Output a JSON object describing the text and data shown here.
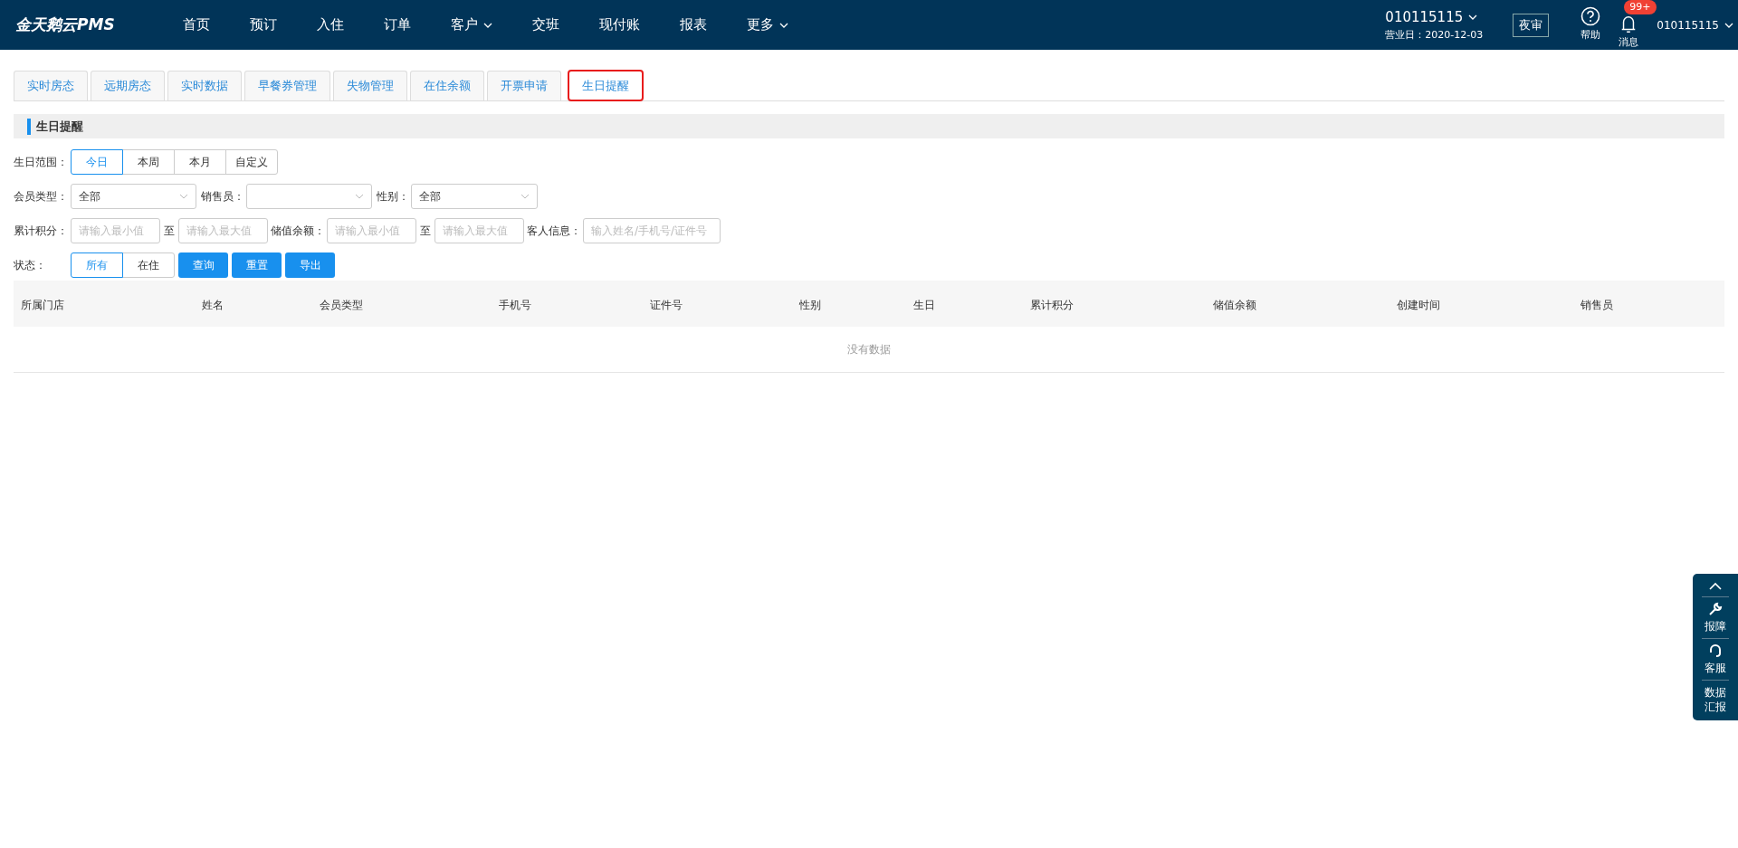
{
  "header": {
    "logo": "金天鹅云PMS",
    "nav": [
      {
        "label": "首页",
        "dropdown": false
      },
      {
        "label": "预订",
        "dropdown": false
      },
      {
        "label": "入住",
        "dropdown": false
      },
      {
        "label": "订单",
        "dropdown": false
      },
      {
        "label": "客户",
        "dropdown": true
      },
      {
        "label": "交班",
        "dropdown": false
      },
      {
        "label": "现付账",
        "dropdown": false
      },
      {
        "label": "报表",
        "dropdown": false
      },
      {
        "label": "更多",
        "dropdown": true
      }
    ],
    "hotel": "010115115",
    "business_date": "营业日：2020-12-03",
    "night_audit": "夜审",
    "help": "帮助",
    "messages": "消息",
    "message_badge": "99+",
    "user": "010115115"
  },
  "tabs": [
    {
      "label": "实时房态",
      "selected": false
    },
    {
      "label": "远期房态",
      "selected": false
    },
    {
      "label": "实时数据",
      "selected": false
    },
    {
      "label": "早餐券管理",
      "selected": false
    },
    {
      "label": "失物管理",
      "selected": false
    },
    {
      "label": "在住余额",
      "selected": false
    },
    {
      "label": "开票申请",
      "selected": false
    },
    {
      "label": "生日提醒",
      "selected": true
    }
  ],
  "section_title": "生日提醒",
  "birthday_range": {
    "label": "生日范围：",
    "options": [
      {
        "label": "今日",
        "selected": true
      },
      {
        "label": "本周",
        "selected": false
      },
      {
        "label": "本月",
        "selected": false
      },
      {
        "label": "自定义",
        "selected": false
      }
    ]
  },
  "selects": [
    {
      "label": "会员类型：",
      "value": "全部"
    },
    {
      "label": "销售员："
    },
    {
      "label": "性别：",
      "value": "全部"
    }
  ],
  "points": {
    "label": "累计积分：",
    "min_placeholder": "请输入最小值",
    "to": "至",
    "max_placeholder": "请输入最大值"
  },
  "balance": {
    "label": "储值余额：",
    "min_placeholder": "请输入最小值",
    "to": "至",
    "max_placeholder": "请输入最大值"
  },
  "guest_info": {
    "label": "客人信息：",
    "placeholder": "输入姓名/手机号/证件号"
  },
  "status": {
    "label": "状态：",
    "options": [
      {
        "label": "所有",
        "selected": true
      },
      {
        "label": "在住",
        "selected": false
      }
    ]
  },
  "actions": [
    "查询",
    "重置",
    "导出"
  ],
  "table": {
    "columns": [
      "所属门店",
      "姓名",
      "会员类型",
      "手机号",
      "证件号",
      "性别",
      "生日",
      "累计积分",
      "储值余额",
      "创建时间",
      "销售员"
    ],
    "empty_text": "没有数据"
  },
  "side_panel": {
    "items": [
      {
        "kind": "tool",
        "label": "报障"
      },
      {
        "kind": "headset",
        "label": "客服"
      },
      {
        "kind": "text",
        "label": "数据汇报"
      }
    ]
  }
}
